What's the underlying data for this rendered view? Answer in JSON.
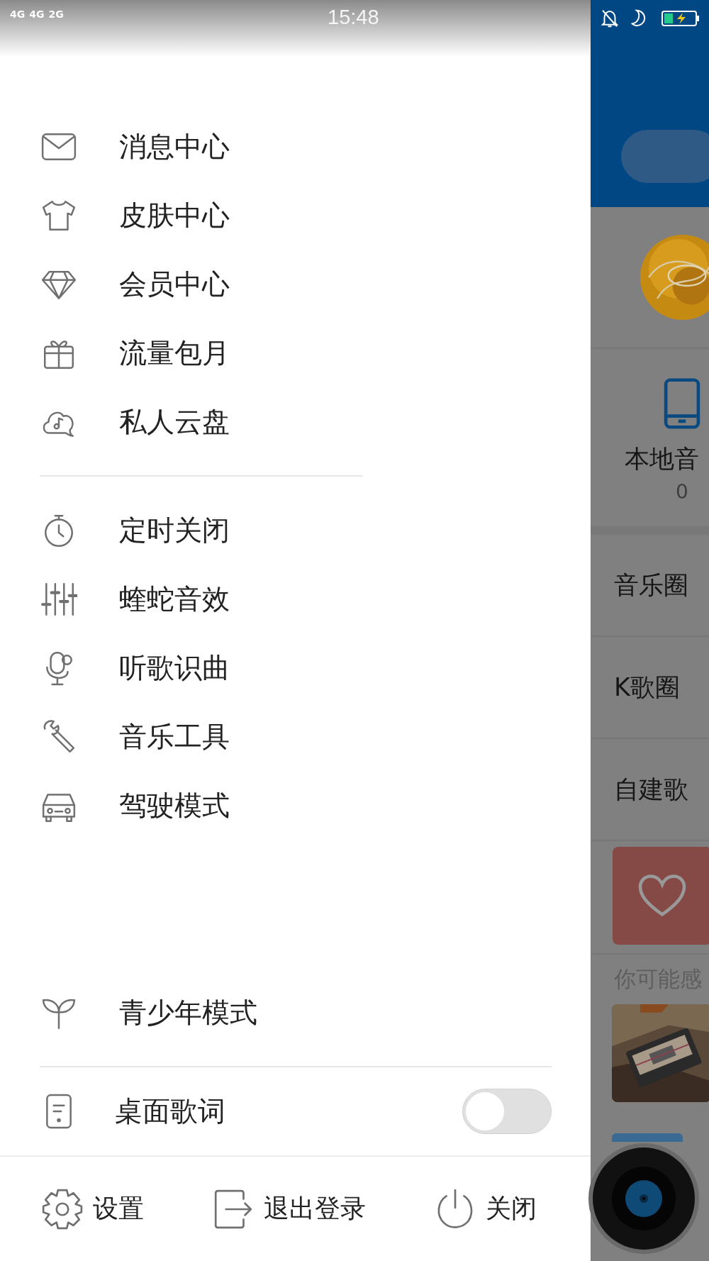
{
  "status_bar": {
    "signals": [
      "4G",
      "4G",
      "2G"
    ],
    "time": "15:48"
  },
  "menu_groups": [
    {
      "items": [
        {
          "label": "消息中心"
        },
        {
          "label": "皮肤中心"
        },
        {
          "label": "会员中心"
        },
        {
          "label": "流量包月"
        },
        {
          "label": "私人云盘"
        }
      ]
    },
    {
      "items": [
        {
          "label": "定时关闭"
        },
        {
          "label": "蝰蛇音效"
        },
        {
          "label": "听歌识曲"
        },
        {
          "label": "音乐工具"
        },
        {
          "label": "驾驶模式"
        }
      ]
    }
  ],
  "youth_mode": {
    "label": "青少年模式"
  },
  "desktop_lyrics": {
    "label": "桌面歌词",
    "on": false
  },
  "bottom_actions": [
    {
      "label": "设置"
    },
    {
      "label": "退出登录"
    },
    {
      "label": "关闭"
    }
  ],
  "background_page": {
    "local_music": {
      "label": "本地音",
      "count": "0"
    },
    "rows": [
      "音乐圈",
      "K歌圈",
      "自建歌"
    ],
    "recommend_title": "你可能感"
  }
}
